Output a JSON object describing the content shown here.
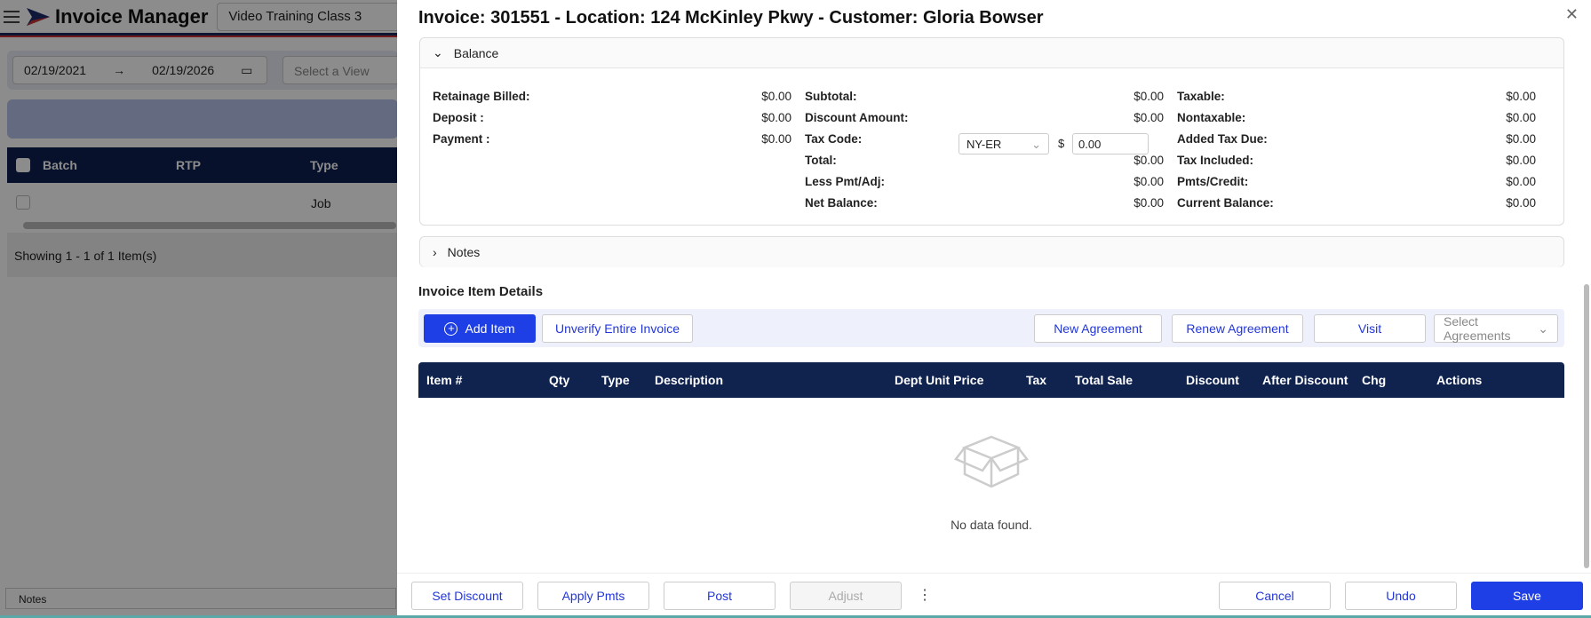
{
  "app": {
    "title": "Invoice Manager",
    "company": "Video Training Class 3",
    "date_from": "02/19/2021",
    "date_to": "02/19/2026",
    "view_placeholder": "Select a View",
    "columns": [
      "Batch",
      "RTP",
      "Type"
    ],
    "row_type": "Job",
    "showing": "Showing 1 - 1 of 1 Item(s)",
    "notes": "Notes"
  },
  "modal": {
    "title": "Invoice: 301551 - Location: 124 McKinley Pkwy - Customer: Gloria Bowser",
    "balance": {
      "label": "Balance",
      "col1": [
        {
          "label": "Retainage Billed:",
          "value": "$0.00"
        },
        {
          "label": "Deposit :",
          "value": "$0.00"
        },
        {
          "label": "Payment :",
          "value": "$0.00"
        }
      ],
      "col2": [
        {
          "label": "Subtotal:",
          "value": "$0.00"
        },
        {
          "label": "Discount Amount:",
          "value": "$0.00"
        },
        {
          "label": "Tax Code:",
          "value": ""
        },
        {
          "label": "Total:",
          "value": "$0.00"
        },
        {
          "label": "Less Pmt/Adj:",
          "value": "$0.00"
        },
        {
          "label": "Net Balance:",
          "value": "$0.00"
        }
      ],
      "col3": [
        {
          "label": "Taxable:",
          "value": "$0.00"
        },
        {
          "label": "Nontaxable:",
          "value": "$0.00"
        },
        {
          "label": "Added Tax Due:",
          "value": "$0.00"
        },
        {
          "label": "Tax Included:",
          "value": "$0.00"
        },
        {
          "label": "Pmts/Credit:",
          "value": "$0.00"
        },
        {
          "label": "Current Balance:",
          "value": "$0.00"
        }
      ],
      "tax_code": "NY-ER",
      "currency": "$",
      "tax_value": "0.00"
    },
    "notes_label": "Notes",
    "items_title": "Invoice Item Details",
    "toolbar": {
      "add_item": "Add Item",
      "unverify": "Unverify Entire Invoice",
      "new_agreement": "New Agreement",
      "renew_agreement": "Renew Agreement",
      "visit": "Visit",
      "select_agreements": "Select Agreements"
    },
    "columns": [
      "Item #",
      "Qty",
      "Type",
      "Description",
      "Dept",
      "Unit Price",
      "Tax",
      "Total Sale",
      "Discount",
      "After Discount",
      "Chg",
      "Actions"
    ],
    "empty": "No data found.",
    "footer": {
      "set_discount": "Set Discount",
      "apply_pmts": "Apply Pmts",
      "post": "Post",
      "adjust": "Adjust",
      "more": "⋮",
      "cancel": "Cancel",
      "undo": "Undo",
      "save": "Save"
    }
  },
  "colors": {
    "primary": "#1f3fe6",
    "header_navy": "#10234f"
  }
}
